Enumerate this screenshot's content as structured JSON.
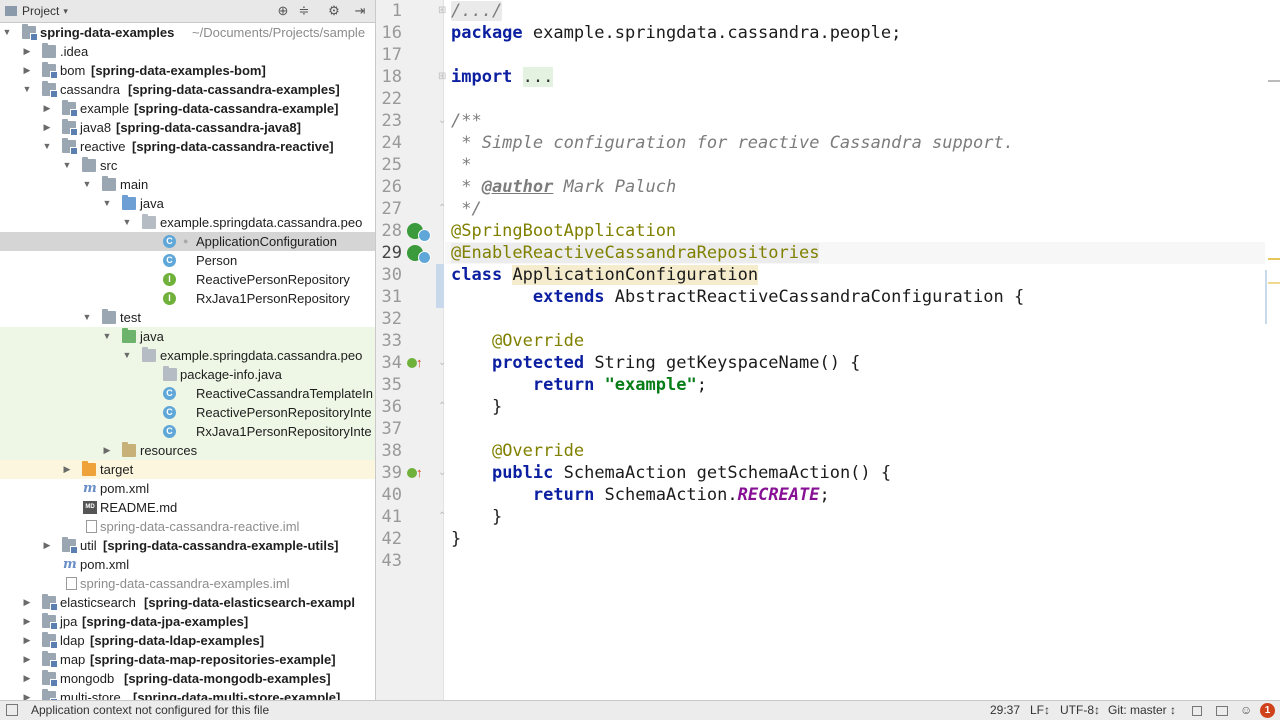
{
  "project_panel": {
    "title": "Project",
    "icons": [
      "target-icon",
      "collapse-icon",
      "gear-icon",
      "hide-icon"
    ]
  },
  "tree": [
    {
      "label": "spring-data-examples",
      "suffix": "~/Documents/Projects/sample",
      "bold": true
    },
    {
      "label": ".idea"
    },
    {
      "label": "bom",
      "module": "[spring-data-examples-bom]"
    },
    {
      "label": "cassandra",
      "module": "[spring-data-cassandra-examples]"
    },
    {
      "label": "example",
      "module": "[spring-data-cassandra-example]"
    },
    {
      "label": "java8",
      "module": "[spring-data-cassandra-java8]"
    },
    {
      "label": "reactive",
      "module": "[spring-data-cassandra-reactive]"
    },
    {
      "label": "src"
    },
    {
      "label": "main"
    },
    {
      "label": "java"
    },
    {
      "label": "example.springdata.cassandra.peo"
    },
    {
      "label": "ApplicationConfiguration"
    },
    {
      "label": "Person"
    },
    {
      "label": "ReactivePersonRepository"
    },
    {
      "label": "RxJava1PersonRepository"
    },
    {
      "label": "test"
    },
    {
      "label": "java"
    },
    {
      "label": "example.springdata.cassandra.peo"
    },
    {
      "label": "package-info.java"
    },
    {
      "label": "ReactiveCassandraTemplateIn"
    },
    {
      "label": "ReactivePersonRepositoryInte"
    },
    {
      "label": "RxJava1PersonRepositoryInte"
    },
    {
      "label": "resources"
    },
    {
      "label": "target"
    },
    {
      "label": "pom.xml"
    },
    {
      "label": "README.md"
    },
    {
      "label": "spring-data-cassandra-reactive.iml"
    },
    {
      "label": "util",
      "module": "[spring-data-cassandra-example-utils]"
    },
    {
      "label": "pom.xml"
    },
    {
      "label": "spring-data-cassandra-examples.iml"
    },
    {
      "label": "elasticsearch",
      "module": "[spring-data-elasticsearch-exampl"
    },
    {
      "label": "jpa",
      "module": "[spring-data-jpa-examples]"
    },
    {
      "label": "ldap",
      "module": "[spring-data-ldap-examples]"
    },
    {
      "label": "map",
      "module": "[spring-data-map-repositories-example]"
    },
    {
      "label": "mongodb",
      "module": "[spring-data-mongodb-examples]"
    },
    {
      "label": "multi-store",
      "module": "[spring-data-multi-store-example]"
    }
  ],
  "editor": {
    "line_numbers": [
      "1",
      "16",
      "17",
      "18",
      "22",
      "23",
      "24",
      "25",
      "26",
      "27",
      "28",
      "29",
      "30",
      "31",
      "32",
      "33",
      "34",
      "35",
      "36",
      "37",
      "38",
      "39",
      "40",
      "41",
      "42",
      "43"
    ],
    "code": {
      "l1": "/.../",
      "pkg_kw": "package",
      "pkg_name": " example.springdata.cassandra.people;",
      "imp_kw": "import",
      "imp_dots": "...",
      "c_open": "/**",
      "c_line1": " * Simple configuration for reactive Cassandra support.",
      "c_star": " *",
      "c_pre": " * ",
      "c_author_tag": "@author",
      "c_author": " Mark Paluch",
      "c_close": " */",
      "ann1": "@SpringBootApplication",
      "ann2": "@EnableReactiveCassandraRepositories",
      "class_kw": "class",
      "class_name": "ApplicationConfiguration",
      "ext_indent": "        ",
      "ext_kw": "extends",
      "ext_rest": " AbstractReactiveCassandraConfiguration {",
      "override": "@Override",
      "protected_kw": "protected",
      "m1_rest": " String getKeyspaceName() {",
      "return_kw": "return",
      "str_example": "\"example\"",
      "semi": ";",
      "brace_close": "}",
      "public_kw": "public",
      "m2_rest": " SchemaAction getSchemaAction() {",
      "ret2_rest": " SchemaAction.",
      "recreate": "RECREATE",
      "class_close": "}"
    }
  },
  "status_bar": {
    "message": "Application context not configured for this file",
    "position": "29:37",
    "line_sep": "LF↕",
    "encoding": "UTF-8↕",
    "vcs": "Git: master ↕",
    "error_count": "1"
  },
  "colors": {
    "keyword": "#0b1fa0",
    "annotation": "#808000",
    "string": "#067d17",
    "comment": "#7c7c7c",
    "static_field": "#871094"
  }
}
